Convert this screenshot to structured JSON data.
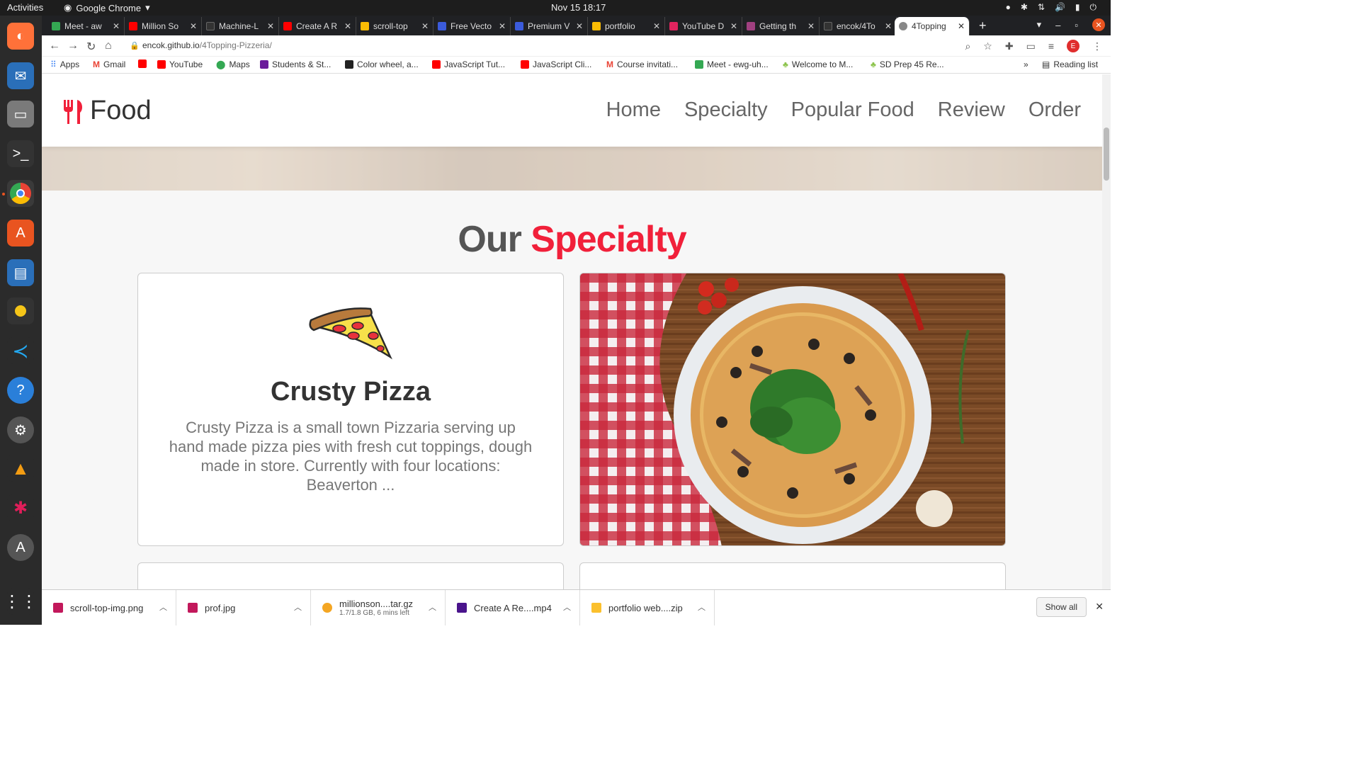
{
  "system": {
    "activities": "Activities",
    "app": "Google Chrome",
    "clock": "Nov 15  18:17"
  },
  "tabs": [
    {
      "title": "Meet - aw",
      "color": "#34a853"
    },
    {
      "title": "Million So",
      "color": "#ff0000"
    },
    {
      "title": "Machine-L",
      "color": "#333333"
    },
    {
      "title": "Create A R",
      "color": "#ff0000"
    },
    {
      "title": "scroll-top",
      "color": "#fbbc04"
    },
    {
      "title": "Free Vecto",
      "color": "#3b5bdb"
    },
    {
      "title": "Premium V",
      "color": "#3b5bdb"
    },
    {
      "title": "portfolio",
      "color": "#fbbc04"
    },
    {
      "title": "YouTube D",
      "color": "#e0245e"
    },
    {
      "title": "Getting th",
      "color": "#a04080"
    },
    {
      "title": "encok/4To",
      "color": "#333333"
    },
    {
      "title": "4Topping",
      "color": "#888888"
    }
  ],
  "address": {
    "host": "encok.github.io",
    "path": "/4Topping-Pizzeria/",
    "avatar": "E"
  },
  "bookmarks": [
    {
      "label": "Apps",
      "color": "#4285f4"
    },
    {
      "label": "Gmail",
      "color": "#ea4335"
    },
    {
      "label": "",
      "color": "#ff0000"
    },
    {
      "label": "YouTube",
      "color": "#ff0000"
    },
    {
      "label": "Maps",
      "color": "#34a853"
    },
    {
      "label": "Students & St...",
      "color": "#6a1b9a"
    },
    {
      "label": "Color wheel, a...",
      "color": "#222222"
    },
    {
      "label": "JavaScript Tut...",
      "color": "#ff0000"
    },
    {
      "label": "JavaScript Cli...",
      "color": "#ff0000"
    },
    {
      "label": "Course invitati...",
      "color": "#ea4335"
    },
    {
      "label": "Meet - ewg-uh...",
      "color": "#34a853"
    },
    {
      "label": "Welcome to M...",
      "color": "#8bc34a"
    },
    {
      "label": "SD Prep 45 Re...",
      "color": "#8bc34a"
    }
  ],
  "reading_list": "Reading list",
  "site": {
    "logo": "Food",
    "nav": [
      "Home",
      "Specialty",
      "Popular Food",
      "Review",
      "Order"
    ],
    "heading_a": "Our",
    "heading_b": "Specialty",
    "card_title": "Crusty Pizza",
    "card_desc": "Crusty Pizza is a small town Pizzaria serving up hand made pizza pies with fresh cut toppings, dough made in store. Currently with four locations: Beaverton ..."
  },
  "downloads": [
    {
      "name": "scroll-top-img.png",
      "sub": "",
      "color": "#c2185b"
    },
    {
      "name": "prof.jpg",
      "sub": "",
      "color": "#c2185b"
    },
    {
      "name": "millionson....tar.gz",
      "sub": "1.7/1.8 GB, 6 mins left",
      "color": "#f4a623"
    },
    {
      "name": "Create A Re....mp4",
      "sub": "",
      "color": "#4a148c"
    },
    {
      "name": "portfolio web....zip",
      "sub": "",
      "color": "#fbc02d"
    }
  ],
  "show_all": "Show all"
}
